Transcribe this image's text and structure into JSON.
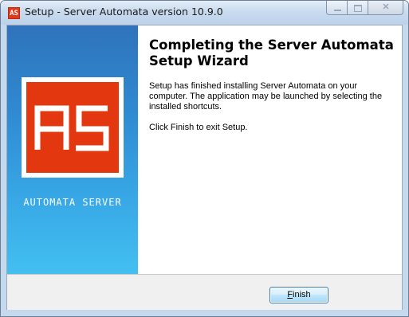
{
  "window": {
    "title": "Setup - Server Automata version 10.9.0",
    "icon": "app-logo-icon",
    "icon_text": "AS"
  },
  "sidebar": {
    "logo_text": "AS",
    "brand": "AUTOMATA SERVER",
    "logo_color": "#e3380f",
    "gradient_top": "#2f73bb",
    "gradient_bottom": "#42c0f0"
  },
  "main": {
    "heading": "Completing the Server Automata Setup Wizard",
    "paragraph1": "Setup has finished installing Server Automata on your computer. The application may be launched by selecting the installed shortcuts.",
    "paragraph2": "Click Finish to exit Setup."
  },
  "footer": {
    "finish_label_mnemonic": "F",
    "finish_label_rest": "inish"
  }
}
